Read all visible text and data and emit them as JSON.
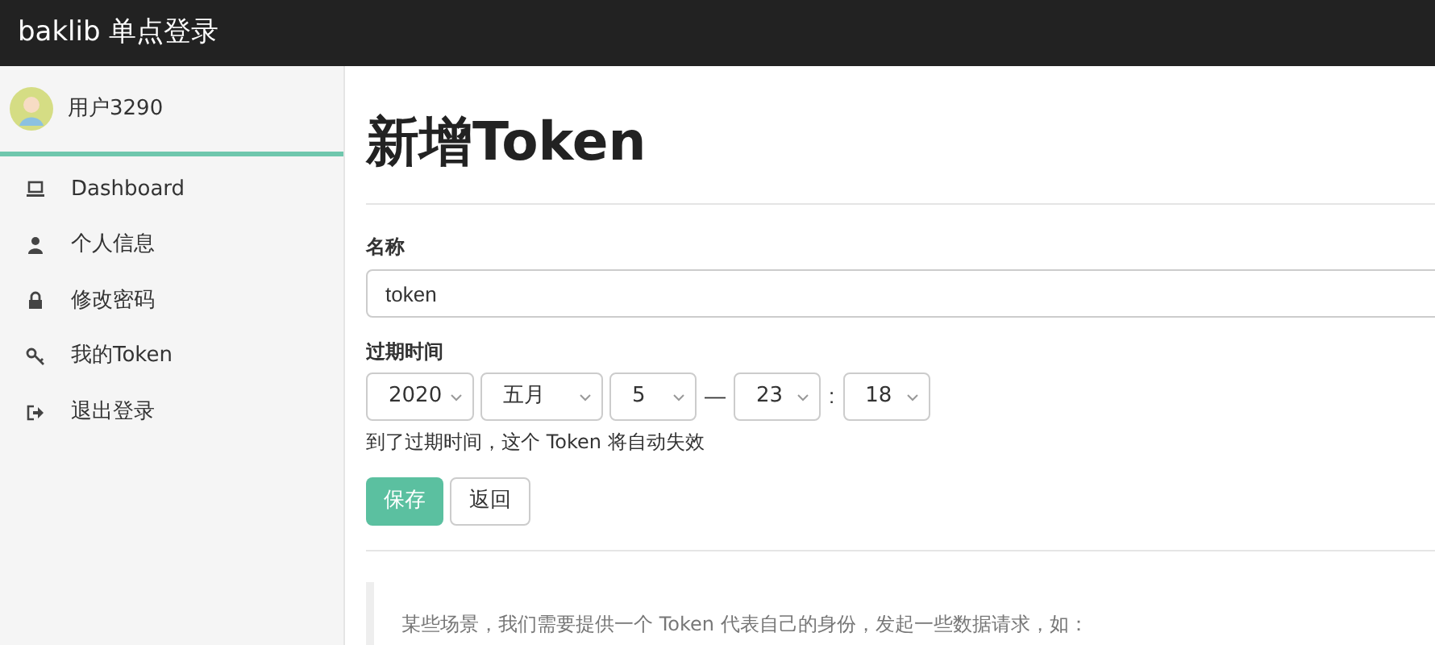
{
  "header": {
    "title": "baklib 单点登录"
  },
  "sidebar": {
    "user": "用户3290",
    "items": [
      {
        "kind": "laptop",
        "label": "Dashboard",
        "selected": false
      },
      {
        "kind": "user",
        "label": "个人信息",
        "selected": false
      },
      {
        "kind": "lock",
        "label": "修改密码",
        "selected": false
      },
      {
        "kind": "key",
        "label": "我的Token",
        "selected": false
      },
      {
        "kind": "logout",
        "label": "退出登录",
        "selected": false
      }
    ]
  },
  "page": {
    "title": "新增Token"
  },
  "form": {
    "name_label": "名称",
    "name_value": "token",
    "expiry_label": "过期时间",
    "expiry": [
      {
        "value": "2020"
      },
      {
        "value": "五月"
      },
      {
        "value": "5"
      },
      {
        "sep": "—",
        "value": "23"
      },
      {
        "sep": ":",
        "value": "18"
      }
    ],
    "hint": "到了过期时间，这个 Token 将自动失效",
    "buttons": [
      {
        "kind": "primary",
        "label": "保存"
      },
      {
        "kind": "default",
        "label": "返回"
      }
    ]
  },
  "note": "某些场景，我们需要提供一个 Token 代表自己的身份，发起一些数据请求，如："
}
